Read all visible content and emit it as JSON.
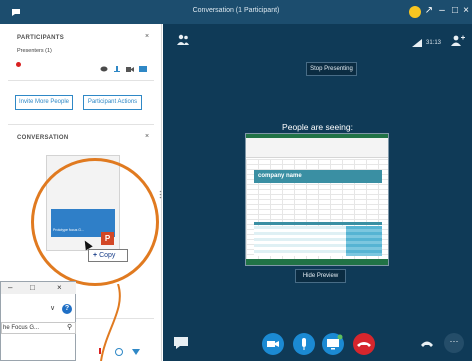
{
  "window": {
    "title": "Conversation (1 Participant)",
    "controls": [
      "–",
      "↘",
      "–",
      "□",
      "×"
    ],
    "colors": {
      "titlebar": "#1c4d6e",
      "stage": "#0f3a57",
      "accent": "#2f88c6",
      "callout": "#e07a20"
    }
  },
  "participants": {
    "header": "PARTICIPANTS",
    "close": "×",
    "presenters_label": "Presenters (1)",
    "invite_label": "Invite More People",
    "actions_label": "Participant Actions"
  },
  "conversation": {
    "header": "CONVERSATION",
    "close": "×"
  },
  "drag": {
    "slide_caption": "Prototype focus G...",
    "copy_label": "Copy",
    "copy_plus": "+",
    "ppt_letter": "P"
  },
  "mini_window": {
    "minimize": "–",
    "maximize": "□",
    "close": "×",
    "chevron": "∨",
    "help": "?",
    "search_text": "he Focus G...",
    "search_icon": "magnifier-icon"
  },
  "stage": {
    "timer": "31:13",
    "stop_presenting": "Stop Presenting",
    "people_seeing": "People are seeing:",
    "hide_preview": "Hide Preview",
    "preview_company": "company name",
    "more": "···"
  }
}
